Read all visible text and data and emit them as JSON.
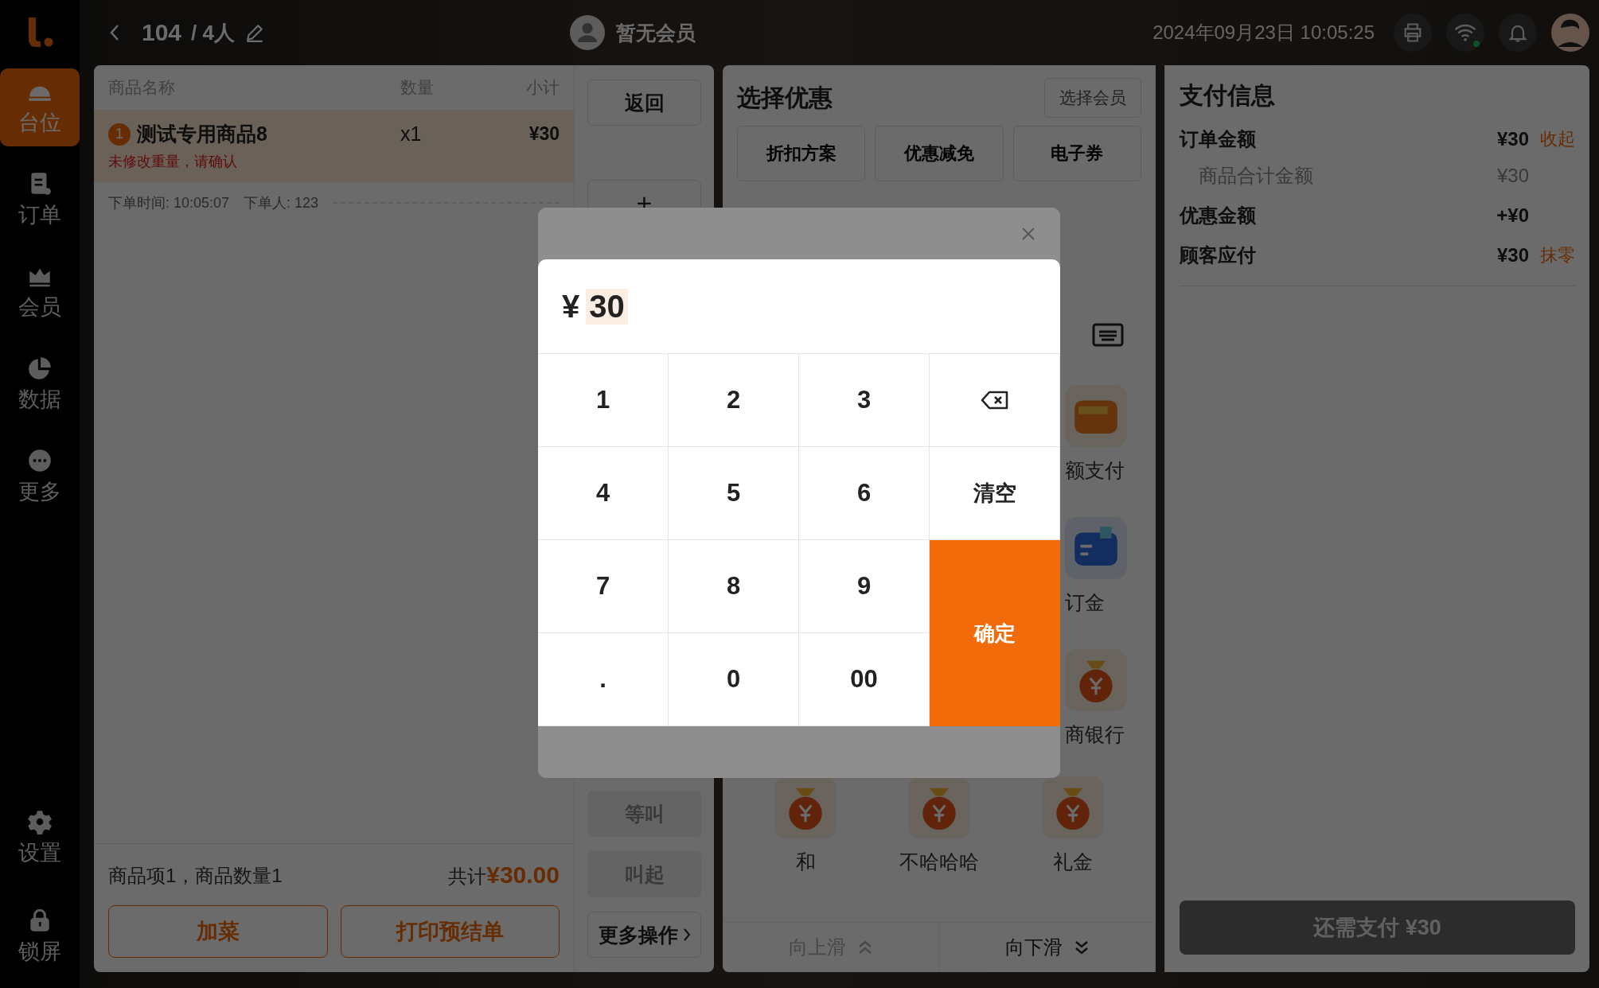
{
  "top_bar": {
    "table_number": "104",
    "guests": "/ 4人",
    "member": "暂无会员",
    "datetime": "2024年09月23日 10:05:25",
    "wifi_connected": true
  },
  "sidebar": {
    "items": [
      {
        "label": "台位",
        "selected": true
      },
      {
        "label": "订单",
        "selected": false
      },
      {
        "label": "会员",
        "selected": false
      },
      {
        "label": "数据",
        "selected": false
      },
      {
        "label": "更多",
        "selected": false
      }
    ],
    "bottom_items": [
      {
        "label": "设置",
        "selected": false
      },
      {
        "label": "锁屏",
        "selected": false
      }
    ]
  },
  "order_panel": {
    "columns": [
      "商品名称",
      "数量",
      "小计"
    ],
    "items": [
      {
        "index": "1",
        "name": "测试专用商品8",
        "qty": "x1",
        "subtotal": "¥30",
        "warning": "未修改重量，请确认",
        "selected": true
      }
    ],
    "order_time": "下单时间: 10:05:07",
    "orderer": "下单人: 123",
    "summary": "商品项1，商品数量1",
    "total_label": "共计",
    "total": "¥30.00",
    "buttons": [
      "加菜",
      "打印预结单"
    ]
  },
  "actions": [
    {
      "label": "返回",
      "kind": "text",
      "disabled": false
    },
    {
      "label": "+",
      "kind": "glyph",
      "disabled": false
    },
    {
      "label": "等叫",
      "kind": "text",
      "disabled": true
    },
    {
      "label": "叫起",
      "kind": "text",
      "disabled": true
    },
    {
      "label": "更多操作",
      "kind": "more",
      "disabled": false
    }
  ],
  "discounts": {
    "title": "选择优惠",
    "member_button": "选择会员",
    "tabs": [
      "折扣方案",
      "优惠减免",
      "电子券"
    ]
  },
  "payment_methods_partial": [
    {
      "label": "额支付"
    },
    {
      "label": "订金"
    },
    {
      "label": "商银行"
    }
  ],
  "payment_methods": [
    {
      "label": "和"
    },
    {
      "label": "不哈哈哈"
    },
    {
      "label": "礼金"
    }
  ],
  "scroll_buttons": [
    {
      "label": "向上滑",
      "disabled": true
    },
    {
      "label": "向下滑",
      "disabled": false
    }
  ],
  "payment_info": {
    "title": "支付信息",
    "rows": [
      {
        "label": "订单金额",
        "value": "¥30",
        "link": "收起",
        "kind": "main"
      },
      {
        "label": "商品合计金额",
        "value": "¥30",
        "kind": "sub"
      },
      {
        "label": "优惠金额",
        "value": "+¥0",
        "kind": "main"
      },
      {
        "label": "顾客应付",
        "value": "¥30",
        "link": "抹零",
        "kind": "main"
      }
    ],
    "pay_button": {
      "label": "还需支付 ¥30",
      "disabled": true
    }
  },
  "keypad_dialog": {
    "currency": "¥",
    "amount": "30",
    "keys": [
      {
        "label": "1",
        "kind": "digit"
      },
      {
        "label": "2",
        "kind": "digit"
      },
      {
        "label": "3",
        "kind": "digit"
      },
      {
        "kind": "backspace"
      },
      {
        "label": "4",
        "kind": "digit"
      },
      {
        "label": "5",
        "kind": "digit"
      },
      {
        "label": "6",
        "kind": "digit"
      },
      {
        "label": "清空",
        "kind": "clear"
      },
      {
        "label": "7",
        "kind": "digit"
      },
      {
        "label": "8",
        "kind": "digit"
      },
      {
        "label": "9",
        "kind": "digit"
      },
      {
        "label": "确定",
        "kind": "confirm"
      },
      {
        "label": ".",
        "kind": "digit"
      },
      {
        "label": "0",
        "kind": "digit"
      },
      {
        "label": "00",
        "kind": "digit"
      }
    ]
  }
}
